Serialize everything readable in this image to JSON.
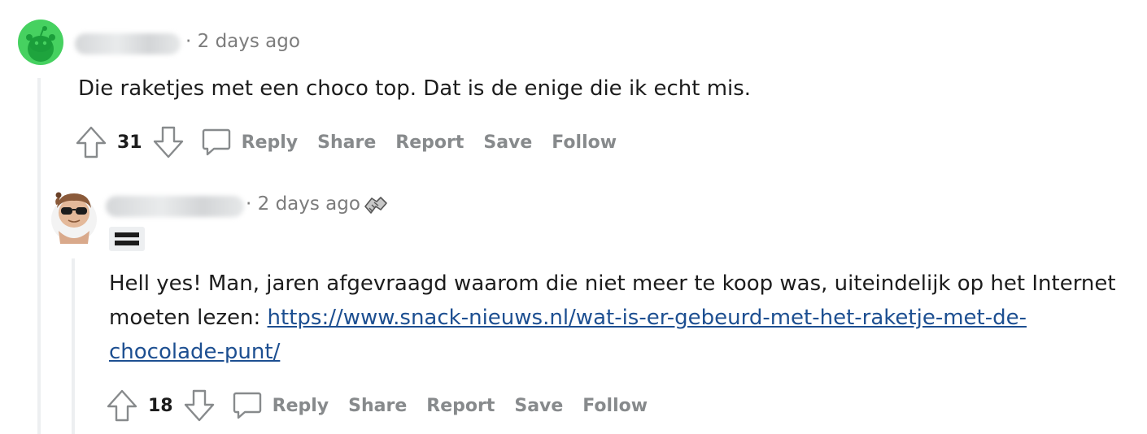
{
  "comments": [
    {
      "timestamp": "2 days ago",
      "body": "Die raketjes met een choco top. Dat is de enige die ik echt mis.",
      "votes": "31",
      "actions": [
        "Reply",
        "Share",
        "Report",
        "Save",
        "Follow"
      ]
    },
    {
      "timestamp": "2 days ago",
      "body_text": "Hell yes! Man, jaren afgevraagd waarom die niet meer te koop was, uiteindelijk op het Internet moeten lezen: ",
      "link": "https://www.snack-nieuws.nl/wat-is-er-gebeurd-met-het-raketje-met-de-chocolade-punt/",
      "votes": "18",
      "actions": [
        "Reply",
        "Share",
        "Report",
        "Save",
        "Follow"
      ]
    }
  ],
  "separator": "·",
  "colors": {
    "link": "#1d4f91",
    "meta": "#7c7c7c",
    "action": "#878a8c",
    "thread_line": "#edeff1",
    "avatar_bg": "#46d160"
  },
  "icons": [
    "snoo-avatar-icon",
    "sunglasses-avatar-icon",
    "handshake-award-icon",
    "flair-equals-icon",
    "upvote-icon",
    "downvote-icon",
    "comment-bubble-icon"
  ]
}
